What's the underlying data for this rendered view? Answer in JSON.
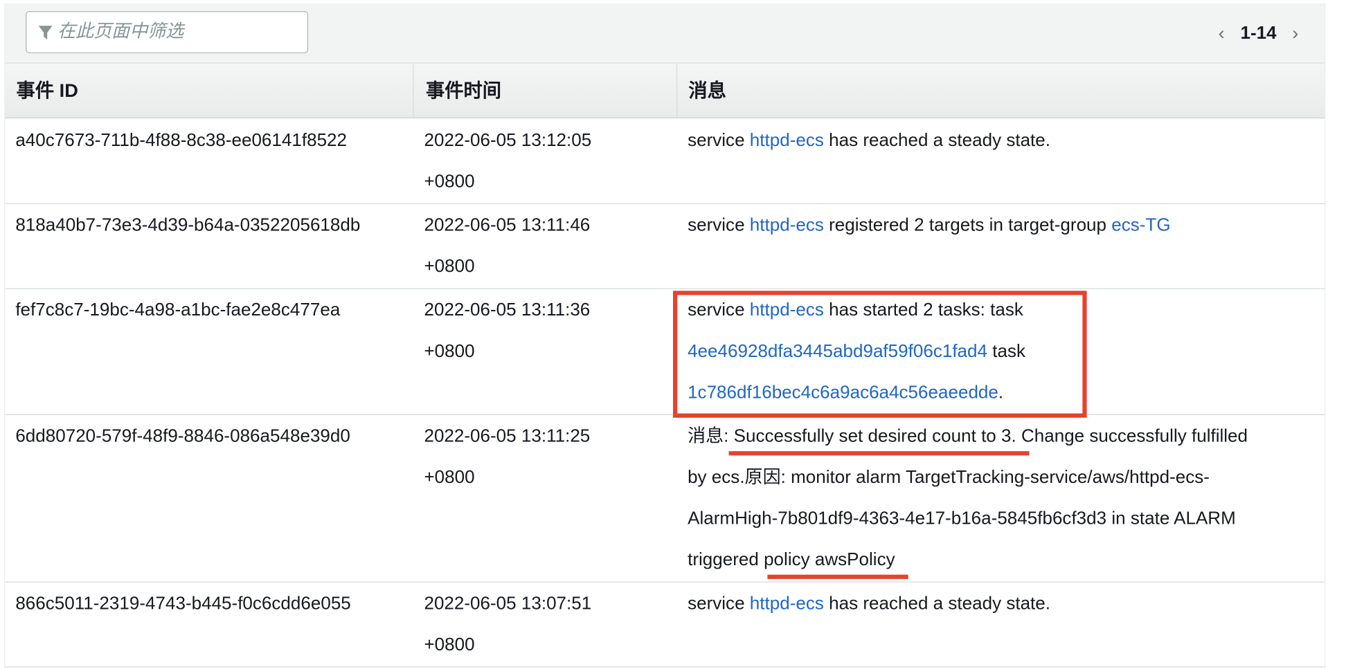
{
  "filter": {
    "placeholder": "在此页面中筛选"
  },
  "pagination": {
    "prev": "‹",
    "range": "1-14",
    "next": "›"
  },
  "columns": [
    "事件 ID",
    "事件时间",
    "消息"
  ],
  "rows": [
    {
      "id": "a40c7673-711b-4f88-8c38-ee06141f8522",
      "time": "2022-06-05 13:12:05",
      "tz": "+0800",
      "msg": {
        "t1": "service ",
        "l1": "httpd-ecs",
        "t2": " has reached a steady state."
      }
    },
    {
      "id": "818a40b7-73e3-4d39-b64a-0352205618db",
      "time": "2022-06-05 13:11:46",
      "tz": "+0800",
      "msg": {
        "t1": "service ",
        "l1": "httpd-ecs",
        "t2": " registered 2 targets in target-group ",
        "l2": "ecs-TG"
      }
    },
    {
      "id": "fef7c8c7-19bc-4a98-a1bc-fae2e8c477ea",
      "time": "2022-06-05 13:11:36",
      "tz": "+0800",
      "msg": {
        "t1": "service ",
        "l1": "httpd-ecs",
        "t2": " has started 2 tasks: task",
        "l2": "4ee46928dfa3445abd9af59f06c1fad4",
        "t3": " task",
        "l3": "1c786df16bec4c6a9ac6a4c56eaeedde",
        "t4": "."
      }
    },
    {
      "id": "6dd80720-579f-48f9-8846-086a548e39d0",
      "time": "2022-06-05 13:11:25",
      "tz": "+0800",
      "msg": {
        "line1": "消息: Successfully set desired count to 3. Change successfully fulfilled",
        "line2": "by ecs.原因: monitor alarm TargetTracking-service/aws/httpd-ecs-",
        "line3": "AlarmHigh-7b801df9-4363-4e17-b16a-5845fb6cf3d3 in state ALARM",
        "line4": "triggered policy awsPolicy"
      }
    },
    {
      "id": "866c5011-2319-4743-b445-f0c6cdd6e055",
      "time": "2022-06-05 13:07:51",
      "tz": "+0800",
      "msg": {
        "t1": "service ",
        "l1": "httpd-ecs",
        "t2": " has reached a steady state."
      }
    }
  ],
  "colors": {
    "link": "#1f66c8",
    "annotation": "#e8412c",
    "header_bg": "#eaeded"
  },
  "icons": {
    "filter": "funnel-icon",
    "prev": "chevron-left-icon",
    "next": "chevron-right-icon"
  }
}
